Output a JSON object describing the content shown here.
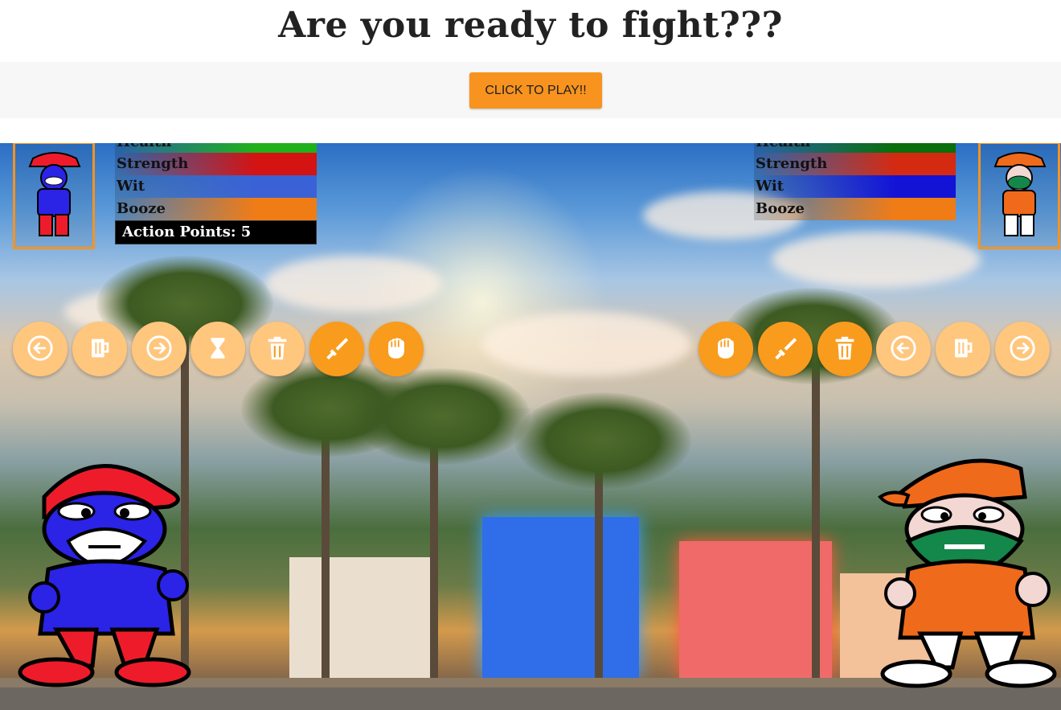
{
  "title": "Are you ready to fight???",
  "play_button": "CLICK TO PLAY!!",
  "player1": {
    "stats": [
      {
        "label": "Health",
        "color": "#21b01b"
      },
      {
        "label": "Strength",
        "color": "#d41313"
      },
      {
        "label": "Wit",
        "color": "#3a62d6"
      },
      {
        "label": "Booze",
        "color": "#f07c16"
      }
    ],
    "action_points": "Action Points: 5",
    "colors": {
      "hat": "#ee1c2b",
      "face": "#2b23e6",
      "shirt": "#2b23e6",
      "pants": "#ee1c2b"
    },
    "actions": [
      {
        "icon": "arrow-left-icon",
        "state": "faded"
      },
      {
        "icon": "beer-mug-icon",
        "state": "faded"
      },
      {
        "icon": "arrow-right-icon",
        "state": "faded"
      },
      {
        "icon": "hourglass-icon",
        "state": "faded"
      },
      {
        "icon": "trash-icon",
        "state": "faded"
      },
      {
        "icon": "sword-icon",
        "state": "bright"
      },
      {
        "icon": "fist-icon",
        "state": "bright"
      }
    ]
  },
  "player2": {
    "stats": [
      {
        "label": "Health",
        "color": "#0a6e0a"
      },
      {
        "label": "Strength",
        "color": "#d42a12"
      },
      {
        "label": "Wit",
        "color": "#1313d6"
      },
      {
        "label": "Booze",
        "color": "#f07c16"
      }
    ],
    "colors": {
      "hat": "#f06a1c",
      "face": "#14874a",
      "shirt": "#f06a1c",
      "pants": "#ffffff"
    },
    "actions": [
      {
        "icon": "fist-icon",
        "state": "bright"
      },
      {
        "icon": "sword-icon",
        "state": "bright"
      },
      {
        "icon": "trash-icon",
        "state": "bright"
      },
      {
        "icon": "arrow-left-icon",
        "state": "faded"
      },
      {
        "icon": "beer-mug-icon",
        "state": "faded"
      },
      {
        "icon": "arrow-right-icon",
        "state": "faded"
      }
    ]
  }
}
